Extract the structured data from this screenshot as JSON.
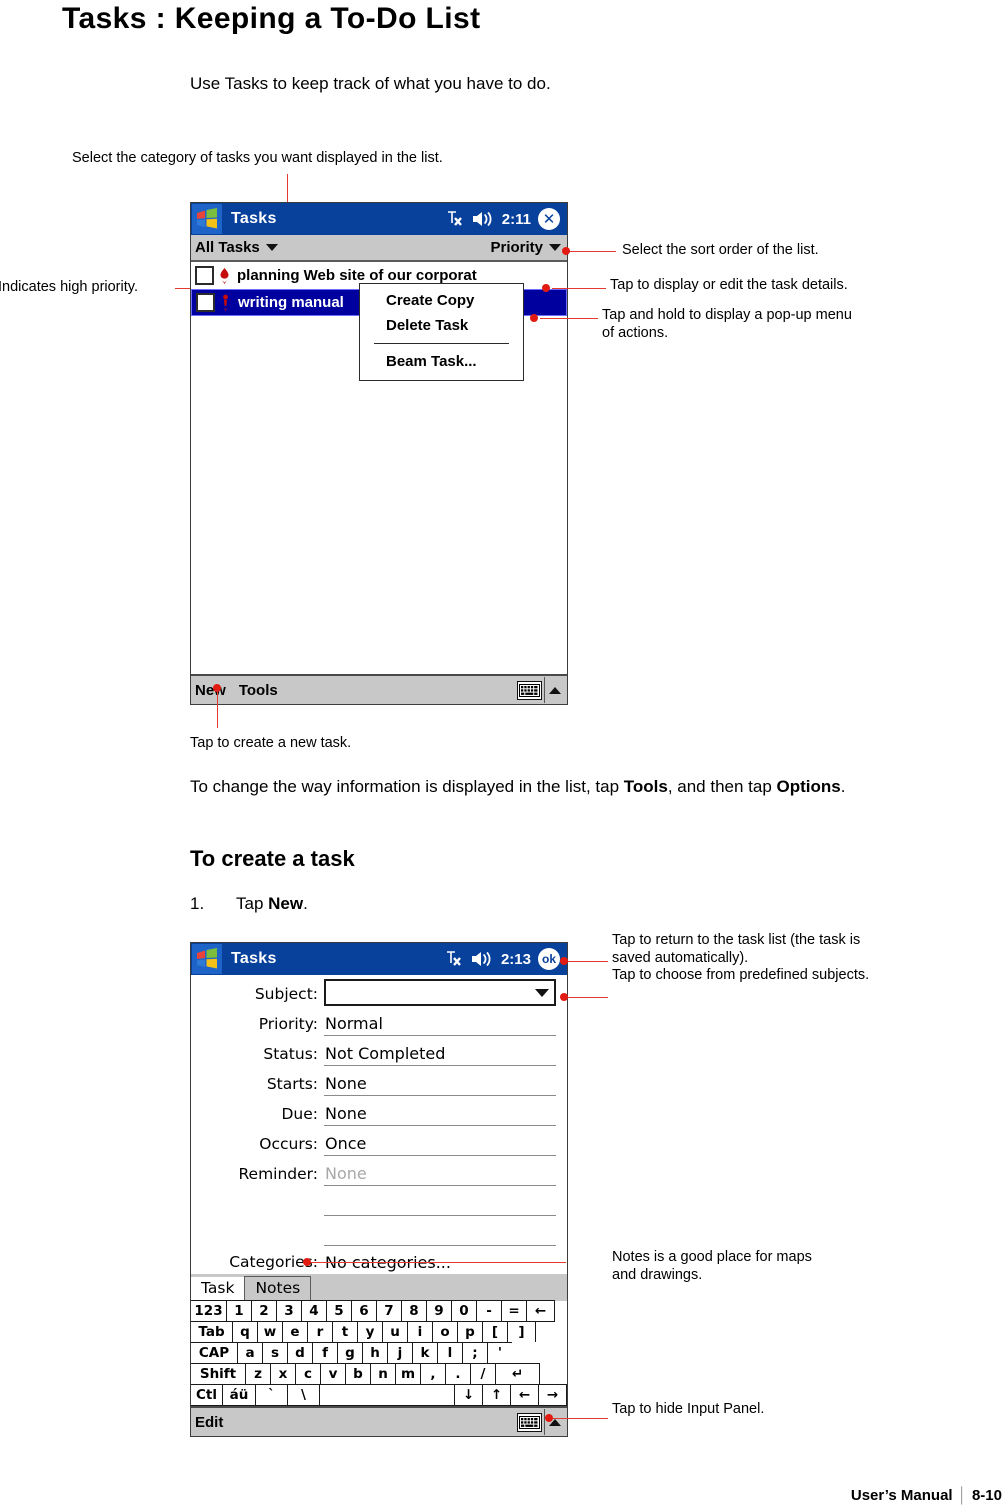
{
  "page": {
    "title": "Tasks : Keeping a To-Do List",
    "intro": "Use Tasks to keep track of what you have to do.",
    "body_text_1_pre": "To change the way information is displayed in the list, tap ",
    "body_text_1_b1": "Tools",
    "body_text_1_mid": ", and then tap ",
    "body_text_1_b2": "Options",
    "body_text_1_end": ".",
    "section_heading": "To create a task",
    "step_number": "1.",
    "step_pre": "Tap ",
    "step_bold": "New",
    "step_end": ".",
    "footer_manual": "User’s Manual",
    "footer_sep": "│",
    "footer_page": "8-10"
  },
  "callouts": {
    "category": "Select the category of tasks you want displayed in the list.",
    "high_priority": "Indicates high priority.",
    "sort_order": "Select the sort order of the list.",
    "task_details": "Tap to display or edit the task details.",
    "popup_menu_l1": "Tap and hold to display a pop-up menu",
    "popup_menu_l2": "of actions.",
    "new_task": "Tap to create a new task.",
    "return_l1": "Tap to return to the task list (the task is",
    "return_l2": "saved automatically).",
    "predefined_subjects": "Tap to choose from predefined subjects.",
    "notes_l1": "Notes is a good place for maps",
    "notes_l2": "and drawings.",
    "hide_panel": "Tap to hide Input Panel."
  },
  "screen1": {
    "titlebar": {
      "app": "Tasks",
      "signal_icon": "antenna-off-icon",
      "volume_icon": "speaker-icon",
      "clock": "2:11",
      "close_icon": "close-icon",
      "close_glyph": "✕"
    },
    "filterbar": {
      "category": "All Tasks",
      "sort": "Priority"
    },
    "tasks": [
      {
        "label": "planning Web site of our corporat",
        "priority": "high",
        "selected": false,
        "checked": false
      },
      {
        "label": "writing manual",
        "priority": "high",
        "selected": true,
        "checked": false
      }
    ],
    "popup": {
      "items": [
        "Create Copy",
        "Delete Task"
      ],
      "items_after": [
        "Beam Task..."
      ]
    },
    "commandbar": {
      "new": "New",
      "tools": "Tools",
      "keyboard_icon": "keyboard-icon",
      "expand_icon": "caret-up-icon"
    }
  },
  "screen2": {
    "titlebar": {
      "app": "Tasks",
      "signal_icon": "antenna-off-icon",
      "volume_icon": "speaker-icon",
      "clock": "2:13",
      "ok_label": "ok"
    },
    "fields": [
      {
        "label": "Subject:",
        "value": "",
        "type": "combo",
        "dim": false
      },
      {
        "label": "Priority:",
        "value": "Normal",
        "type": "line",
        "dim": false
      },
      {
        "label": "Status:",
        "value": "Not Completed",
        "type": "line",
        "dim": false
      },
      {
        "label": "Starts:",
        "value": "None",
        "type": "line",
        "dim": false
      },
      {
        "label": "Due:",
        "value": "None",
        "type": "line",
        "dim": false
      },
      {
        "label": "Occurs:",
        "value": "Once",
        "type": "line",
        "dim": false
      },
      {
        "label": "Reminder:",
        "value": "None",
        "type": "line",
        "dim": true
      },
      {
        "label": "",
        "value": "",
        "type": "line",
        "dim": false
      },
      {
        "label": "",
        "value": "",
        "type": "line",
        "dim": false
      },
      {
        "label": "Categories:",
        "value": "No categories...",
        "type": "plain",
        "dim": false
      }
    ],
    "tabs": [
      {
        "label": "Task",
        "active": true
      },
      {
        "label": "Notes",
        "active": false
      }
    ],
    "keyboard": {
      "rows": [
        [
          "123",
          "1",
          "2",
          "3",
          "4",
          "5",
          "6",
          "7",
          "8",
          "9",
          "0",
          "-",
          "=",
          "←"
        ],
        [
          "Tab",
          "q",
          "w",
          "e",
          "r",
          "t",
          "y",
          "u",
          "i",
          "o",
          "p",
          "[",
          "]"
        ],
        [
          "CAP",
          "a",
          "s",
          "d",
          "f",
          "g",
          "h",
          "j",
          "k",
          "l",
          ";",
          "'"
        ],
        [
          "Shift",
          "z",
          "x",
          "c",
          "v",
          "b",
          "n",
          "m",
          ",",
          ".",
          "/",
          "↵"
        ],
        [
          "Ctl",
          "áü",
          "`",
          "\\",
          "",
          "↓",
          "↑",
          "←",
          "→"
        ]
      ]
    },
    "commandbar": {
      "edit": "Edit",
      "keyboard_icon": "keyboard-icon",
      "expand_icon": "caret-up-icon"
    }
  },
  "colors": {
    "titlebar": "#08419b",
    "selection": "#00009e",
    "chrome": "#c8c8c8",
    "callout_red": "#e11b12"
  }
}
